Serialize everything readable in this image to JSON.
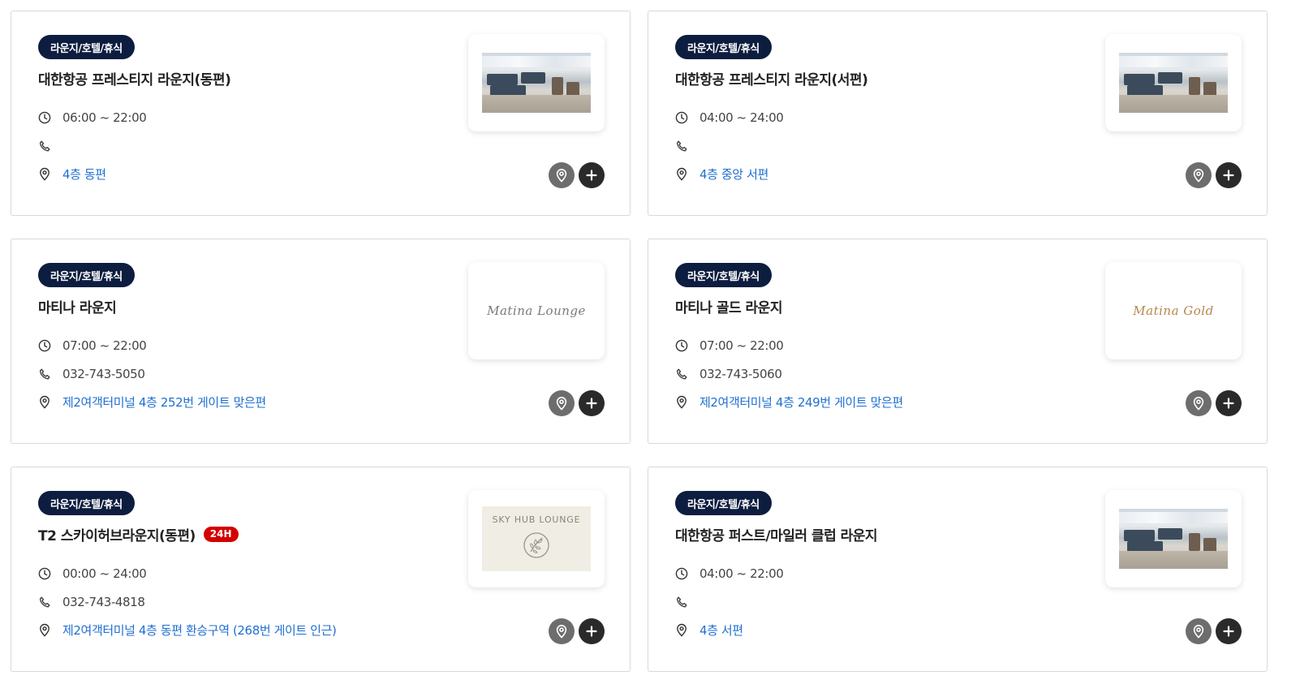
{
  "cards": [
    {
      "category": "라운지/호텔/휴식",
      "title": "대한항공 프레스티지 라운지(동편)",
      "hours": "06:00 ~ 22:00",
      "phone": "",
      "location": "4층 동편",
      "image": "lounge-photo"
    },
    {
      "category": "라운지/호텔/휴식",
      "title": "대한항공 프레스티지 라운지(서편)",
      "hours": "04:00 ~ 24:00",
      "phone": "",
      "location": "4층 중앙 서편",
      "image": "lounge-photo"
    },
    {
      "category": "라운지/호텔/휴식",
      "title": "마티나 라운지",
      "hours": "07:00 ~ 22:00",
      "phone": "032-743-5050",
      "location": "제2여객터미널 4층 252번 게이트 맞은편",
      "image": "matina-lounge-logo",
      "logo_text": "Matina Lounge"
    },
    {
      "category": "라운지/호텔/휴식",
      "title": "마티나 골드 라운지",
      "hours": "07:00 ~ 22:00",
      "phone": "032-743-5060",
      "location": "제2여객터미널 4층 249번 게이트 맞은편",
      "image": "matina-gold-logo",
      "logo_text": "Matina Gold"
    },
    {
      "category": "라운지/호텔/휴식",
      "title": "T2 스카이허브라운지(동편)",
      "tag": "24H",
      "hours": "00:00 ~ 24:00",
      "phone": "032-743-4818",
      "location": "제2여객터미널 4층 동편 환승구역 (268번 게이트 인근)",
      "image": "sky-hub-logo",
      "logo_text": "SKY HUB LOUNGE"
    },
    {
      "category": "라운지/호텔/휴식",
      "title": "대한항공 퍼스트/마일러 클럽 라운지",
      "hours": "04:00 ~ 22:00",
      "phone": "",
      "location": "4층 서편",
      "image": "lounge-photo"
    }
  ],
  "colors": {
    "badge_bg": "#0d1d3f",
    "link": "#1f6fd1",
    "tag_24h": "#d50000",
    "map_button": "#6d6d6d",
    "add_button": "#2a2a2a"
  },
  "icons": {
    "hours": "clock-icon",
    "phone": "phone-icon",
    "location": "map-pin-icon",
    "map_button": "map-pin-icon",
    "add_button": "plus-icon"
  }
}
